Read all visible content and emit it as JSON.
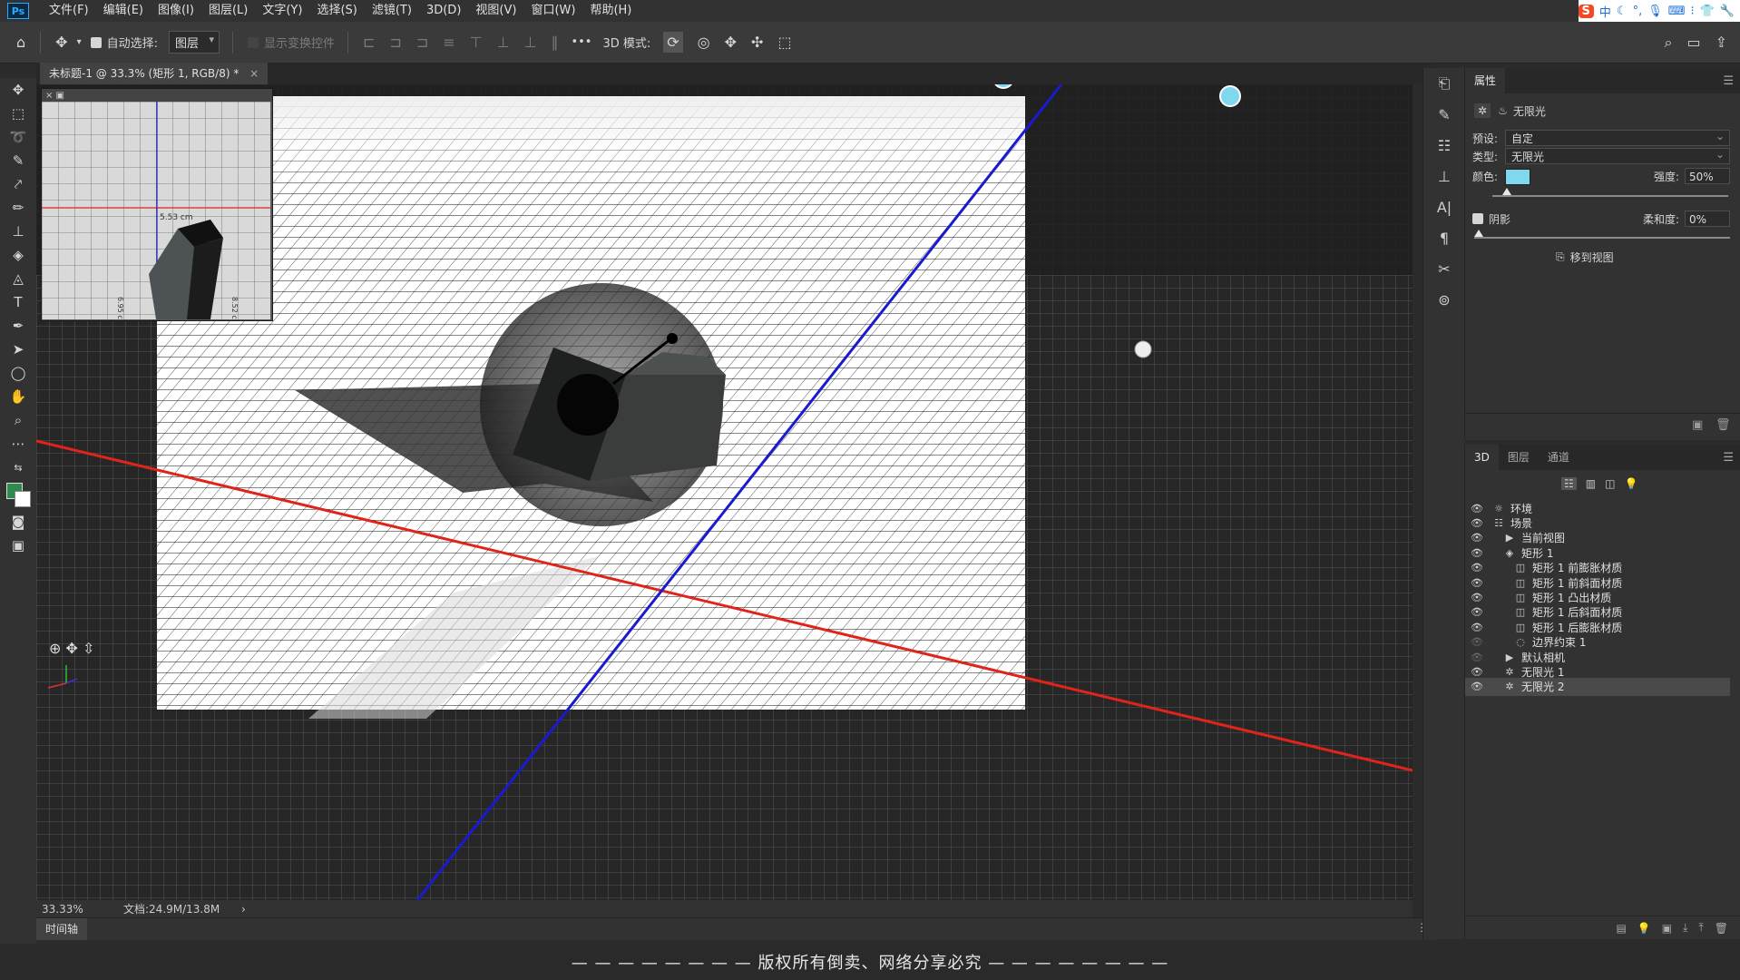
{
  "app": {
    "logo": "Ps"
  },
  "menu": [
    "文件(F)",
    "编辑(E)",
    "图像(I)",
    "图层(L)",
    "文字(Y)",
    "选择(S)",
    "滤镜(T)",
    "3D(D)",
    "视图(V)",
    "窗口(W)",
    "帮助(H)"
  ],
  "ime": {
    "logo": "S",
    "lang": "中"
  },
  "options": {
    "auto_select_label": "自动选择:",
    "auto_select_target": "图层",
    "show_transform": "显示变换控件",
    "mode_3d_label": "3D 模式:",
    "more": "•••"
  },
  "document": {
    "tab_title": "未标题-1 @ 33.3% (矩形 1, RGB/8) *",
    "close": "×"
  },
  "navigator": {
    "measure": "5.53 cm",
    "side_a": "6.95 cm",
    "side_b": "8.52 cm"
  },
  "status": {
    "zoom": "33.33%",
    "doc": "文档:24.9M/13.8M",
    "arrow": "›"
  },
  "timeline": {
    "tab": "时间轴"
  },
  "banner": "— — — — — — — — 版权所有倒卖、网络分享必究 — — — — — — — —",
  "properties": {
    "tab": "属性",
    "light_type_title": "无限光",
    "preset_label": "预设:",
    "preset_value": "自定",
    "type_label": "类型:",
    "type_value": "无限光",
    "color_label": "颜色:",
    "color_value": "#7fd8ee",
    "intensity_label": "强度:",
    "intensity_value": "50%",
    "intensity_level": 0.06,
    "shadow_label": "阴影",
    "softness_label": "柔和度:",
    "softness_value": "0%",
    "softness_level": 0.0,
    "move_to_view": "移到视图"
  },
  "panel3d": {
    "tabs": [
      "3D",
      "图层",
      "通道"
    ],
    "items": [
      {
        "label": "环境",
        "icon": "environment-icon",
        "indent": 0,
        "eye": true,
        "selected": false
      },
      {
        "label": "场景",
        "icon": "scene-icon",
        "indent": 0,
        "eye": true,
        "selected": false
      },
      {
        "label": "当前视图",
        "icon": "camera-icon",
        "indent": 1,
        "eye": true,
        "selected": false
      },
      {
        "label": "矩形 1",
        "icon": "mesh-icon",
        "indent": 1,
        "eye": true,
        "selected": false
      },
      {
        "label": "矩形 1 前膨胀材质",
        "icon": "material-icon",
        "indent": 2,
        "eye": true,
        "selected": false
      },
      {
        "label": "矩形 1 前斜面材质",
        "icon": "material-icon",
        "indent": 2,
        "eye": true,
        "selected": false
      },
      {
        "label": "矩形 1 凸出材质",
        "icon": "material-icon",
        "indent": 2,
        "eye": true,
        "selected": false
      },
      {
        "label": "矩形 1 后斜面材质",
        "icon": "material-icon",
        "indent": 2,
        "eye": true,
        "selected": false
      },
      {
        "label": "矩形 1 后膨胀材质",
        "icon": "material-icon",
        "indent": 2,
        "eye": true,
        "selected": false
      },
      {
        "label": "边界约束 1",
        "icon": "constraint-icon",
        "indent": 2,
        "eye": false,
        "selected": false
      },
      {
        "label": "默认相机",
        "icon": "camera-icon",
        "indent": 1,
        "eye": false,
        "selected": false
      },
      {
        "label": "无限光 1",
        "icon": "light-icon",
        "indent": 1,
        "eye": true,
        "selected": false
      },
      {
        "label": "无限光 2",
        "icon": "light-icon",
        "indent": 1,
        "eye": true,
        "selected": true
      }
    ]
  },
  "colors": {
    "accent": "#31a8ff",
    "grid_red": "#e0241b",
    "grid_blue": "#1a1ad0",
    "light_color": "#7fd8ee"
  }
}
